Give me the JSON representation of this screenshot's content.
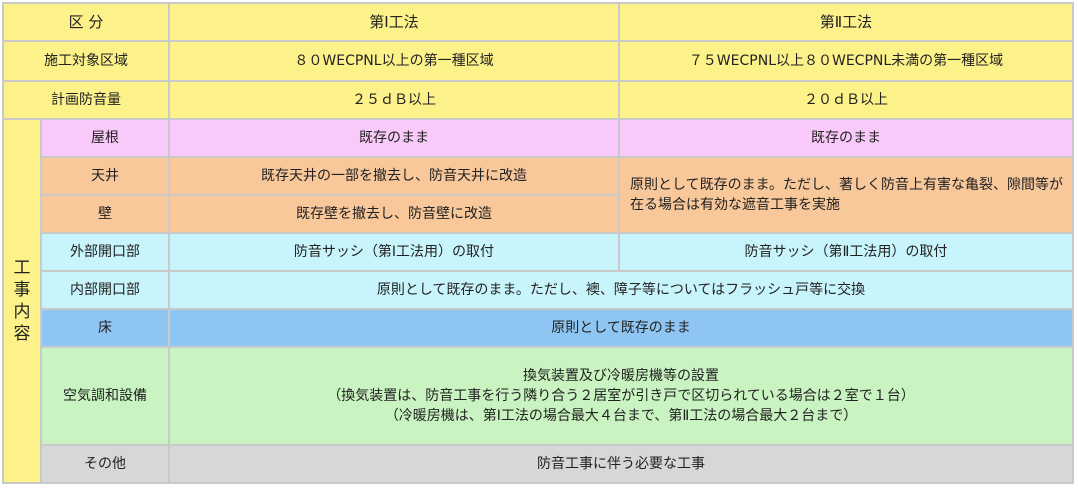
{
  "header": {
    "category": "区 分",
    "method1": "第Ⅰ工法",
    "method2": "第Ⅱ工法"
  },
  "rows": {
    "target_area": {
      "label": "施工対象区域",
      "m1": "８０WECPNL以上の第一種区域",
      "m2": "７５WECPNL以上８０WECPNL未満の第一種区域"
    },
    "sound_reduction": {
      "label": "計画防音量",
      "m1": "２５ｄＢ以上",
      "m2": "２０ｄＢ以上"
    }
  },
  "works_label_chars": [
    "工",
    "事",
    "内",
    "容"
  ],
  "works": {
    "roof": {
      "label": "屋根",
      "m1": "既存のまま",
      "m2": "既存のまま"
    },
    "ceiling": {
      "label": "天井",
      "m1": "既存天井の一部を撤去し、防音天井に改造"
    },
    "wall": {
      "label": "壁",
      "m1": "既存壁を撤去し、防音壁に改造"
    },
    "ceiling_wall_m2": "原則として既存のまま。ただし、著しく防音上有害な亀裂、隙間等が在る場合は有効な遮音工事を実施",
    "exterior_openings": {
      "label": "外部開口部",
      "m1": "防音サッシ（第Ⅰ工法用）の取付",
      "m2": "防音サッシ（第Ⅱ工法用）の取付"
    },
    "interior_openings": {
      "label": "内部開口部",
      "both": "原則として既存のまま。ただし、襖、障子等についてはフラッシュ戸等に交換"
    },
    "floor": {
      "label": "床",
      "both": "原則として既存のまま"
    },
    "air_conditioning": {
      "label": "空気調和設備",
      "line1": "換気装置及び冷暖房機等の設置",
      "line2": "（換気装置は、防音工事を行う隣り合う２居室が引き戸で区切られている場合は２室で１台）",
      "line3": "（冷暖房機は、第Ⅰ工法の場合最大４台まで、第Ⅱ工法の場合最大２台まで）"
    },
    "other": {
      "label": "その他",
      "both": "防音工事に伴う必要な工事"
    }
  }
}
